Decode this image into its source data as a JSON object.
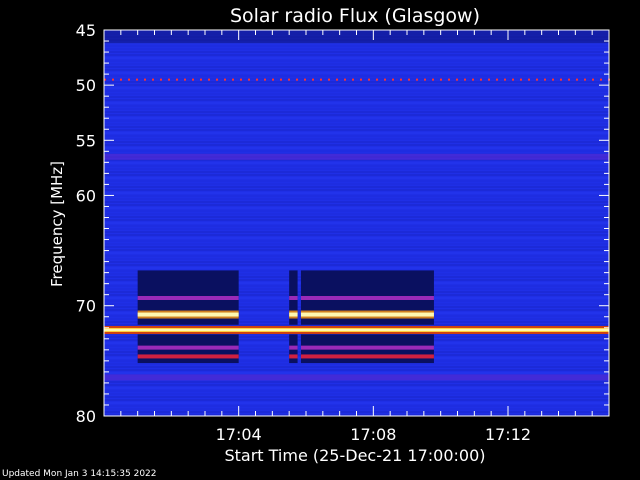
{
  "chart_data": {
    "type": "heatmap",
    "title": "Solar radio Flux (Glasgow)",
    "xlabel": "Start Time (25-Dec-21 17:00:00)",
    "ylabel": "Frequency [MHz]",
    "x_range_minutes": [
      0,
      15
    ],
    "y_range_mhz": [
      45,
      80
    ],
    "y_ticks": [
      {
        "value": 45,
        "label": "45"
      },
      {
        "value": 50,
        "label": "50"
      },
      {
        "value": 55,
        "label": "55"
      },
      {
        "value": 60,
        "label": "60"
      },
      {
        "value": 70,
        "label": "70"
      },
      {
        "value": 80,
        "label": "80"
      }
    ],
    "x_ticks": [
      {
        "value": 4,
        "label": "17:04"
      },
      {
        "value": 8,
        "label": "17:08"
      },
      {
        "value": 12,
        "label": "17:12"
      }
    ],
    "background_color": "#1f2fe6",
    "bands": [
      {
        "freq_mhz": 49.5,
        "intensity": "dotted-red",
        "from_min": 0,
        "to_min": 15
      },
      {
        "freq_mhz": 56.5,
        "intensity": "elevated",
        "from_min": 0,
        "to_min": 15
      },
      {
        "freq_mhz": 72.2,
        "intensity": "very-high",
        "from_min": 0,
        "to_min": 15
      },
      {
        "freq_mhz": 76.5,
        "intensity": "elevated",
        "from_min": 0,
        "to_min": 15
      }
    ],
    "interference_blocks": [
      {
        "from_min": 1.0,
        "to_min": 4.0
      },
      {
        "from_min": 5.5,
        "to_min": 5.75
      },
      {
        "from_min": 5.85,
        "to_min": 9.8
      }
    ],
    "block_freq_range_mhz": [
      66.8,
      75.2
    ],
    "block_lines": [
      {
        "freq_mhz": 69.3,
        "intensity": "purple"
      },
      {
        "freq_mhz": 70.8,
        "intensity": "very-high"
      },
      {
        "freq_mhz": 73.8,
        "intensity": "purple"
      },
      {
        "freq_mhz": 74.6,
        "intensity": "red"
      }
    ]
  },
  "footer": {
    "updated": "Updated Mon Jan  3 14:15:35 2022"
  }
}
